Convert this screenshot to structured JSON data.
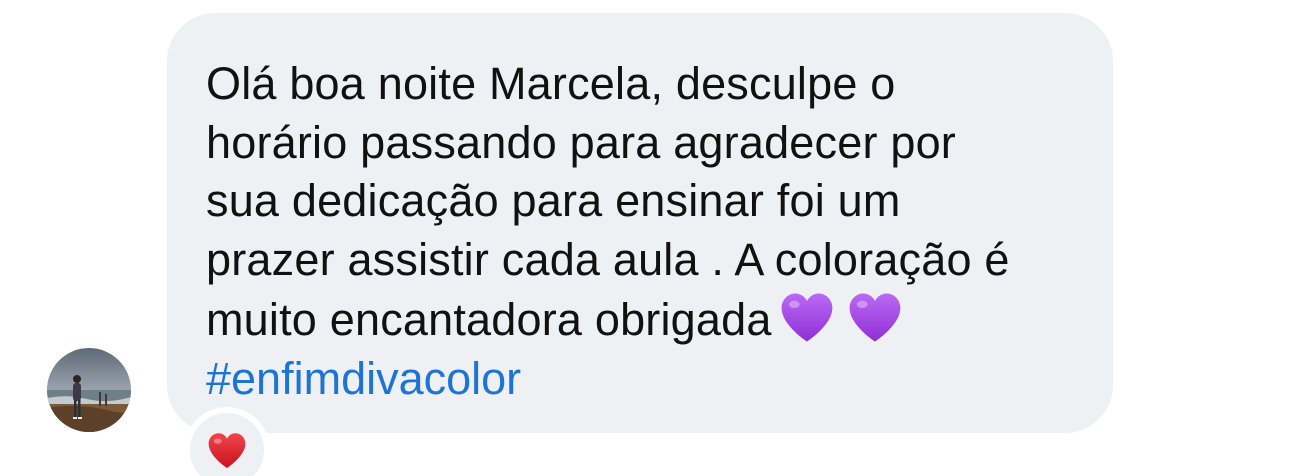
{
  "message": {
    "lines": [
      "Olá boa noite Marcela, desculpe o",
      "horário passando para agradecer por",
      "sua dedicação para ensinar foi um",
      "prazer assistir cada aula . A coloração é",
      "muito encantadora obrigada"
    ],
    "emojis": [
      "purple-heart",
      "purple-heart"
    ],
    "hashtag": "#enfimdivacolor"
  },
  "reaction": {
    "emoji": "red-heart"
  },
  "colors": {
    "bubble_background": "#eff0f3",
    "text": "#111111",
    "hashtag": "#1b74d6",
    "purple_heart": "#a64ce8",
    "red_heart": "#e0232e"
  }
}
